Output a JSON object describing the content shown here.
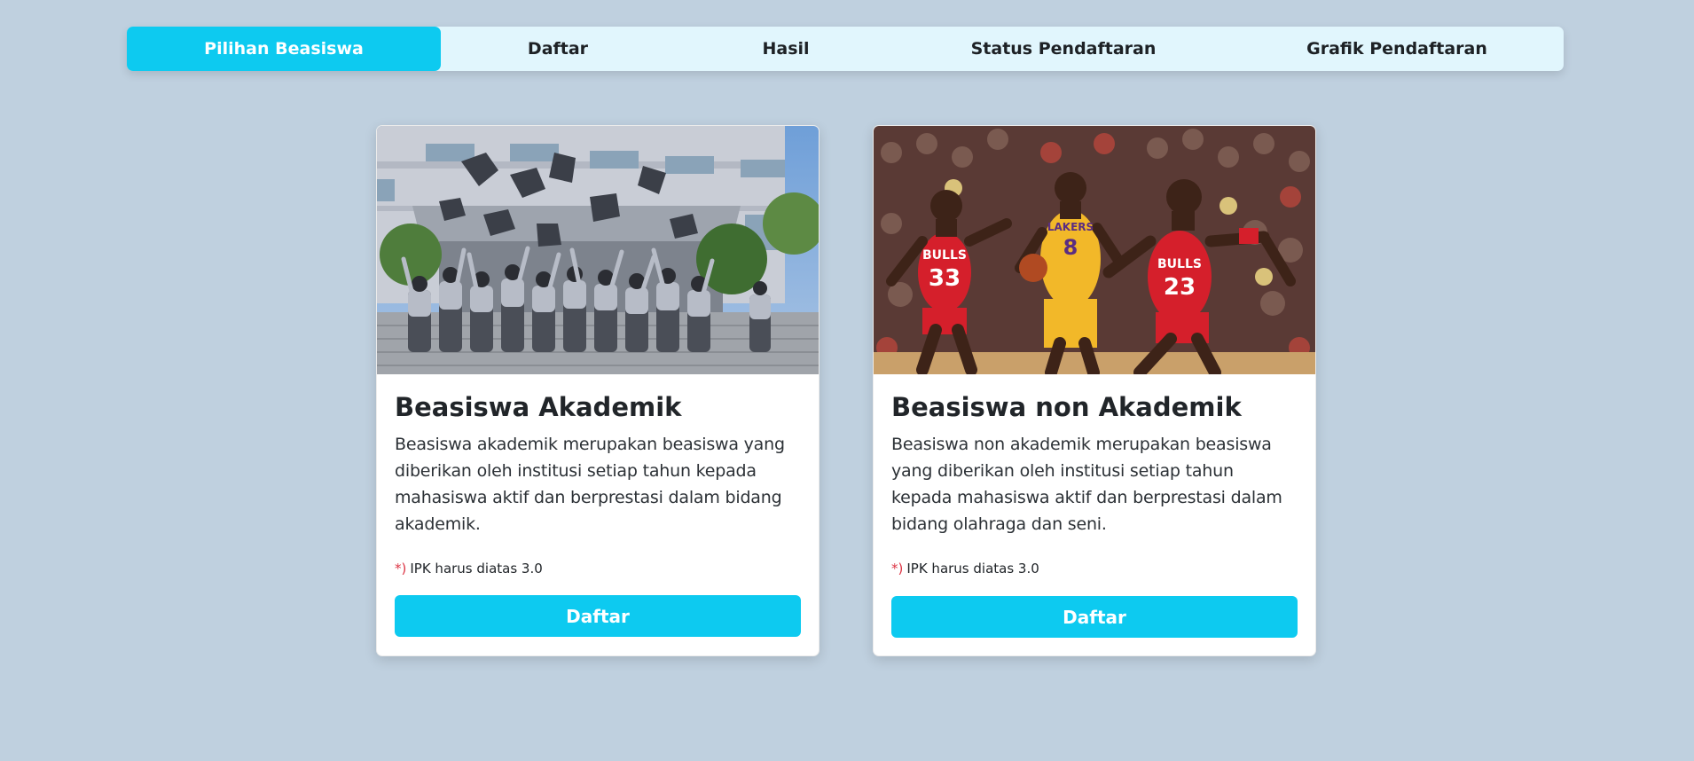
{
  "nav": {
    "items": [
      {
        "label": "Pilihan Beasiswa",
        "active": true
      },
      {
        "label": "Daftar",
        "active": false
      },
      {
        "label": "Hasil",
        "active": false
      },
      {
        "label": "Status Pendaftaran",
        "active": false
      },
      {
        "label": "Grafik Pendaftaran",
        "active": false
      }
    ]
  },
  "cards": [
    {
      "image": "graduation-photo",
      "title": "Beasiswa Akademik",
      "text": "Beasiswa akademik merupakan beasiswa yang diberikan oleh institusi setiap tahun kepada mahasiswa aktif dan berprestasi dalam bidang akademik.",
      "note_marker": "*)",
      "note": "IPK harus diatas 3.0",
      "button_label": "Daftar"
    },
    {
      "image": "basketball-photo",
      "title": "Beasiswa non Akademik",
      "text": "Beasiswa non akademik merupakan beasiswa yang diberikan oleh institusi setiap tahun kepada mahasiswa aktif dan berprestasi dalam bidang olahraga dan seni.",
      "note_marker": "*)",
      "note": "IPK harus diatas 3.0",
      "button_label": "Daftar"
    }
  ],
  "colors": {
    "background": "#bfd0df",
    "accent": "#0dcaf0",
    "nav_bg": "#e1f6fd",
    "required": "#dc3545"
  }
}
